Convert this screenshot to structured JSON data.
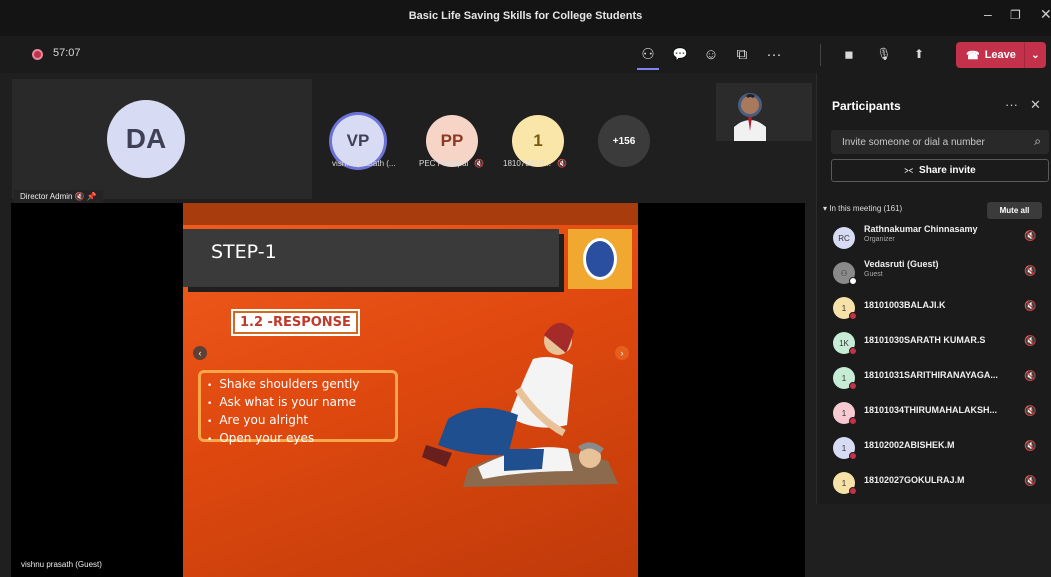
{
  "window": {
    "title": "Basic Life Saving Skills for College Students",
    "minimize": "–",
    "maximize": "❐",
    "close": "✕"
  },
  "toolbar": {
    "timer": "57:07",
    "icons": {
      "people": "⚇",
      "chat": "💬",
      "reactions": "☺",
      "rooms": "⧉",
      "more": "···",
      "camera": "◼",
      "mic": "🎙",
      "share": "⬆"
    },
    "leave_label": "Leave",
    "leave_icon": "☎",
    "leave_chevron": "⌄",
    "leave_color": "#c4314b"
  },
  "stage": {
    "main_tile": {
      "initials": "DA",
      "name": "Director Admin",
      "indicators": "🔇 📌"
    },
    "gallery": [
      {
        "initials": "VP",
        "name": "vishnu prasath (...",
        "bg": "#d7dbf3",
        "color": "#3f3f55"
      },
      {
        "initials": "PP",
        "name": "PEC Principal",
        "bg": "#f6d5c7",
        "color": "#8a3a22"
      },
      {
        "initials": "1",
        "name": "18107048R...",
        "bg": "#fbe6a9",
        "color": "#7a5a10"
      },
      {
        "initials": "+156",
        "name": "",
        "bg": "#3b3b3b",
        "color": "#ffffff"
      }
    ],
    "shared_by": "vishnu prasath (Guest)"
  },
  "slide": {
    "title": "STEP-1",
    "subtitle": "1.2 -RESPONSE",
    "bullets": [
      "Shake shoulders gently",
      "Ask what is your name",
      "Are you alright",
      "Open your eyes"
    ],
    "prev": "‹",
    "next": "›"
  },
  "participants": {
    "header": "Participants",
    "more": "···",
    "close": "✕",
    "invite_placeholder": "Invite someone or dial a number",
    "search_icon": "⌕",
    "share_invite": "Share invite",
    "share_icon": "⪥",
    "section": "In this meeting (161)",
    "mute_all": "Mute all",
    "mute_icon": "🔇",
    "list": [
      {
        "initials": "RC",
        "name": "Rathnakumar Chinnasamy",
        "role": "Organizer",
        "bg": "#d7dbf3"
      },
      {
        "initials": "⚇",
        "name": "Vedasruti (Guest)",
        "role": "Guest",
        "bg": "#8a8a8a"
      },
      {
        "initials": "1",
        "name": "18101003BALAJI.K",
        "role": "",
        "bg": "#f6e1a8"
      },
      {
        "initials": "1K",
        "name": "18101030SARATH KUMAR.S",
        "role": "",
        "bg": "#c6ecd5"
      },
      {
        "initials": "1",
        "name": "18101031SARITHIRANAYAGA...",
        "role": "",
        "bg": "#c6ecd5"
      },
      {
        "initials": "1",
        "name": "18101034THIRUMAHALAKSH...",
        "role": "",
        "bg": "#f7c9d2"
      },
      {
        "initials": "1",
        "name": "18102002ABISHEK.M",
        "role": "",
        "bg": "#d7dbf3"
      },
      {
        "initials": "1",
        "name": "18102027GOKULRAJ.M",
        "role": "",
        "bg": "#f6e1a8"
      }
    ]
  }
}
